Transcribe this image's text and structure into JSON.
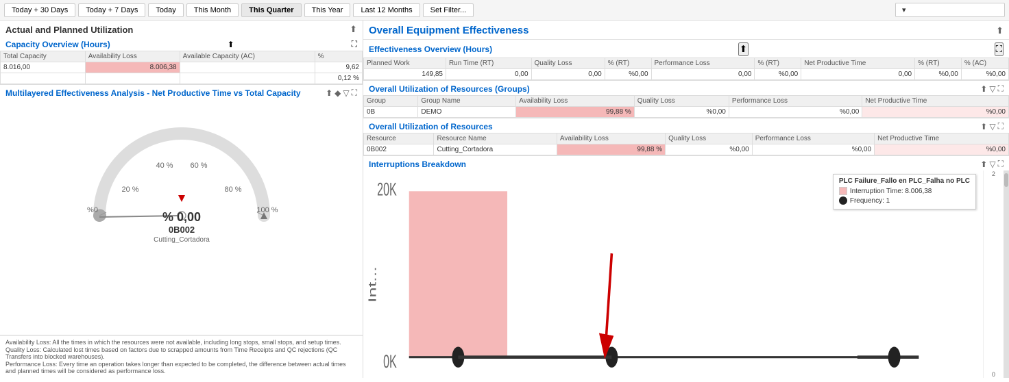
{
  "topbar": {
    "buttons": [
      {
        "label": "Today + 30 Days",
        "active": false
      },
      {
        "label": "Today + 7 Days",
        "active": false
      },
      {
        "label": "Today",
        "active": false
      },
      {
        "label": "This Month",
        "active": false
      },
      {
        "label": "This Quarter",
        "active": true
      },
      {
        "label": "This Year",
        "active": false
      },
      {
        "label": "Last 12 Months",
        "active": false
      },
      {
        "label": "Set Filter...",
        "active": false
      }
    ],
    "dropdown_placeholder": ""
  },
  "left": {
    "title": "Actual and Planned Utilization",
    "capacity": {
      "title": "Capacity Overview (Hours)",
      "columns": [
        "Total Capacity",
        "Availability Loss",
        "Available Capacity (AC)",
        "%"
      ],
      "row": {
        "total_capacity": "8.016,00",
        "availability_loss": "8.006,38",
        "available_capacity": "",
        "percent": "9,62",
        "percent2": "0,12 %"
      }
    },
    "analysis": {
      "title": "Multilayered Effectiveness Analysis - Net Productive Time vs Total Capacity",
      "gauge": {
        "value": "% 0,00",
        "name": "0B002",
        "sub": "Cutting_Cortadora",
        "percent_labels": [
          "20 %",
          "40 %",
          "60 %",
          "80 %",
          "100 %",
          "%0"
        ]
      }
    },
    "footnotes": [
      "Availability Loss: All the times in which the resources were not available, including long stops, small stops, and setup times.",
      "Quality Loss: Calculated lost times based on factors due to scrapped amounts from Time Receipts and QC rejections (QC Transfers into blocked warehouses).",
      "Performance Loss: Every time an operation takes longer than expected to be completed, the difference between actual times and planned times will be considered as performance loss."
    ]
  },
  "right": {
    "oe_title": "Overall Equipment Effectiveness",
    "effectiveness": {
      "title": "Effectiveness Overview (Hours)",
      "columns": [
        "Planned Work",
        "Run Time (RT)",
        "Quality Loss",
        "% (RT)",
        "Performance Loss",
        "% (RT)",
        "Net Productive Time",
        "% (RT)",
        "% (AC)"
      ],
      "row": {
        "planned_work": "149,85",
        "run_time": "0,00",
        "quality_loss": "0,00",
        "pct_rt1": "%0,00",
        "performance_loss": "0,00",
        "pct_rt2": "%0,00",
        "net_productive": "0,00",
        "pct_rt3": "%0,00",
        "pct_ac": "%0,00"
      }
    },
    "resources_groups": {
      "title": "Overall Utilization of Resources (Groups)",
      "columns": [
        "Group",
        "Group Name",
        "Availability Loss",
        "Quality Loss",
        "Performance Loss",
        "Net Productive Time"
      ],
      "row": {
        "group": "0B",
        "group_name": "DEMO",
        "avail_loss": "99,88 %",
        "quality_loss": "%0,00",
        "perf_loss": "%0,00",
        "net_prod": "%0,00"
      }
    },
    "resources": {
      "title": "Overall Utilization of Resources",
      "columns": [
        "Resource",
        "Resource Name",
        "Availability Loss",
        "Quality Loss",
        "Performance Loss",
        "Net Productive Time"
      ],
      "row": {
        "resource": "0B002",
        "resource_name": "Cutting_Cortadora",
        "avail_loss": "99,88 %",
        "quality_loss": "%0,00",
        "perf_loss": "%0,00",
        "net_prod": "%0,00"
      }
    },
    "interruptions": {
      "title": "Interruptions Breakdown",
      "chart": {
        "y_labels": [
          "20K",
          "0K"
        ],
        "y_axis_label": "Int...",
        "bars": [
          {
            "height": 80,
            "color": "#f5b8b8"
          }
        ]
      },
      "tooltip": {
        "title": "PLC Failure_Fallo en PLC_Falha no PLC",
        "rows": [
          {
            "label": "Interruption Time: 8.006,38",
            "color": "#f5b8b8"
          },
          {
            "label": "Frequency: 1",
            "color": "#333"
          }
        ]
      }
    }
  }
}
